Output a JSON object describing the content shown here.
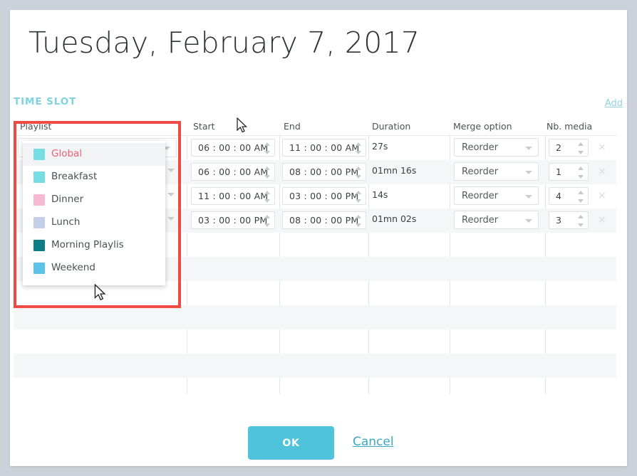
{
  "page": {
    "title": "Tuesday, February 7, 2017",
    "section_label": "TIME SLOT",
    "add_label": "Add"
  },
  "colors": {
    "accent": "#4ec3d9",
    "section_label": "#7fd3e0",
    "link": "#3aa9c4",
    "highlight_box": "#ef4a44",
    "selected_item_text": "#ec5f78"
  },
  "table": {
    "headers": {
      "playlist": "Playlist",
      "start": "Start",
      "end": "End",
      "duration": "Duration",
      "merge_option": "Merge option",
      "nb_media": "Nb. media"
    },
    "rows": [
      {
        "playlist": "Breakfast",
        "playlist_color": "#76dde3",
        "start": "06 : 00 : 00 AM",
        "end": "11 : 00 : 00 AM",
        "duration": "27s",
        "merge_option": "Reorder",
        "nb_media": "2",
        "delete_label": "×"
      },
      {
        "playlist": "",
        "playlist_color": "#76dde3",
        "start": "06 : 00 : 00 AM",
        "end": "08 : 00 : 00 PM",
        "duration": "01mn 16s",
        "merge_option": "Reorder",
        "nb_media": "1",
        "delete_label": "×"
      },
      {
        "playlist": "",
        "playlist_color": "#76dde3",
        "start": "11 : 00 : 00 AM",
        "end": "03 : 00 : 00 PM",
        "duration": "14s",
        "merge_option": "Reorder",
        "nb_media": "4",
        "delete_label": "×"
      },
      {
        "playlist": "",
        "playlist_color": "#76dde3",
        "start": "03 : 00 : 00 PM",
        "end": "08 : 00 : 00 PM",
        "duration": "01mn 02s",
        "merge_option": "Reorder",
        "nb_media": "3",
        "delete_label": "×"
      }
    ]
  },
  "playlist_dropdown": {
    "open": true,
    "selected": "Global",
    "options": [
      {
        "label": "Global",
        "color": "#76dde3",
        "selected": true
      },
      {
        "label": "Breakfast",
        "color": "#76dde3",
        "selected": false
      },
      {
        "label": "Dinner",
        "color": "#f6b9cf",
        "selected": false
      },
      {
        "label": "Lunch",
        "color": "#c3cfe6",
        "selected": false
      },
      {
        "label": "Morning Playlis",
        "color": "#0e7e86",
        "selected": false
      },
      {
        "label": "Weekend",
        "color": "#5ec3e8",
        "selected": false
      }
    ]
  },
  "footer": {
    "ok_label": "OK",
    "cancel_label": "Cancel"
  }
}
